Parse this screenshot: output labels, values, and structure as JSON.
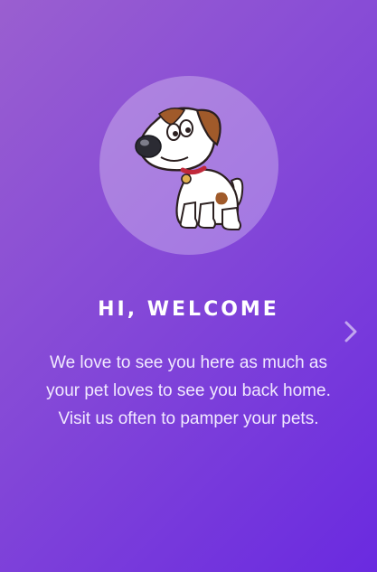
{
  "welcome": {
    "title": "HI, WELCOME",
    "message": "We love to see you here as much as your pet loves to see you back home. Visit us often to pamper your pets."
  },
  "icons": {
    "illustration": "dog-illustration",
    "next": "chevron-right-icon"
  },
  "colors": {
    "gradient_start": "#9a5fd0",
    "gradient_end": "#6a2ae0",
    "title": "#ffffff",
    "text": "#f1e9ff"
  }
}
